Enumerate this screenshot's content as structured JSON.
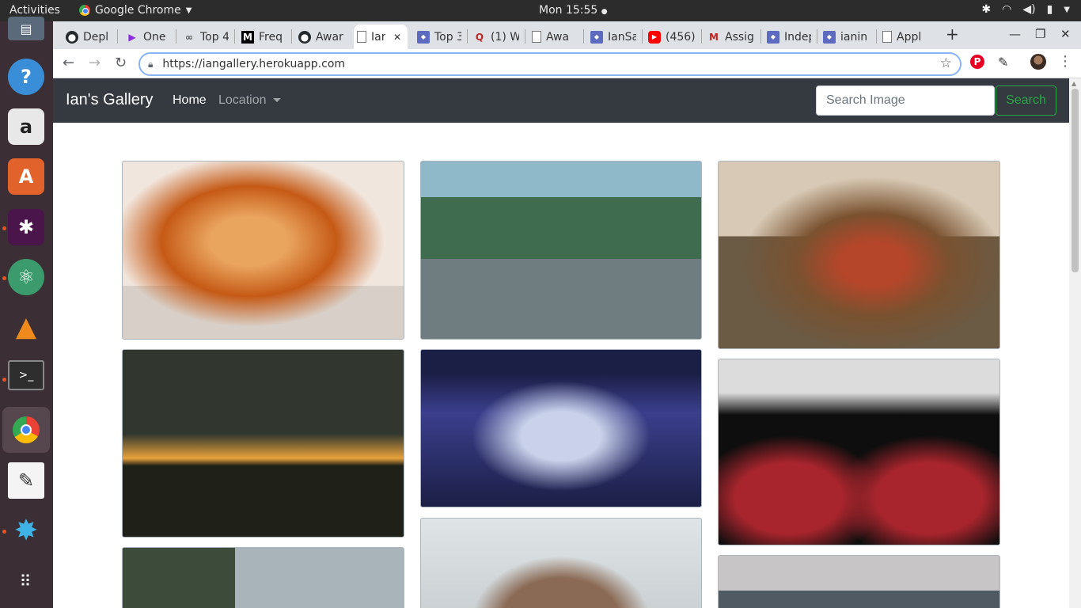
{
  "system": {
    "activities": "Activities",
    "app_name": "Google Chrome",
    "clock": "Mon 15:55"
  },
  "dock": {
    "items": [
      "help-icon",
      "amazon-icon",
      "software-center-icon",
      "slack-icon",
      "atom-icon",
      "vlc-icon",
      "terminal-icon",
      "chrome-icon",
      "text-editor-icon",
      "app-icon",
      "show-apps-icon"
    ]
  },
  "tabs": [
    {
      "icon": "github-icon",
      "label": "Depl"
    },
    {
      "icon": "play-icon",
      "label": "One"
    },
    {
      "icon": "link-icon",
      "label": "Top 4"
    },
    {
      "icon": "medium-icon",
      "label": "Freq"
    },
    {
      "icon": "github-icon",
      "label": "Awar"
    },
    {
      "icon": "page-icon",
      "label": "Iar",
      "active": true
    },
    {
      "icon": "site-icon",
      "label": "Top 3"
    },
    {
      "icon": "quora-icon",
      "label": "(1) W"
    },
    {
      "icon": "page-icon",
      "label": "Awa"
    },
    {
      "icon": "site-icon",
      "label": "IanSa"
    },
    {
      "icon": "youtube-icon",
      "label": "(456)"
    },
    {
      "icon": "gmail-icon",
      "label": "Assig"
    },
    {
      "icon": "site-icon",
      "label": "Indep"
    },
    {
      "icon": "site-icon",
      "label": "ianin"
    },
    {
      "icon": "page-icon",
      "label": "Appl"
    }
  ],
  "browser": {
    "url": "https://iangallery.herokuapp.com"
  },
  "navbar": {
    "brand": "Ian's Gallery",
    "home": "Home",
    "location": "Location",
    "search_placeholder": "Search Image",
    "search_button": "Search"
  },
  "gallery": {
    "images": [
      {
        "subject": "orange cat",
        "colors": [
          "#c55a16",
          "#e9a45e",
          "#f1e6dd"
        ]
      },
      {
        "subject": "person on dock by mountain lake",
        "colors": [
          "#8fb8c9",
          "#3f6b4f",
          "#6f7c80"
        ]
      },
      {
        "subject": "rooster and hen",
        "colors": [
          "#7a5230",
          "#b5462a",
          "#d7c9b5"
        ]
      },
      {
        "subject": "people jumping at sunset",
        "colors": [
          "#31372f",
          "#e8a23b",
          "#1f2118"
        ]
      },
      {
        "subject": "mercedes cars",
        "colors": [
          "#3b3f8c",
          "#c9d2ea",
          "#1c1f45"
        ]
      },
      {
        "subject": "red car interior",
        "colors": [
          "#0e0e0e",
          "#a8252d",
          "#dcdcdc"
        ]
      },
      {
        "subject": "city street",
        "colors": [
          "#3c4b3a",
          "#a9b3ba",
          "#222"
        ]
      },
      {
        "subject": "man portrait",
        "colors": [
          "#dfe4e6",
          "#8a6a54",
          "#c7cdd0"
        ]
      },
      {
        "subject": "parking lot",
        "colors": [
          "#c8c5c6",
          "#4f5a63",
          "#7d8893"
        ]
      }
    ]
  }
}
